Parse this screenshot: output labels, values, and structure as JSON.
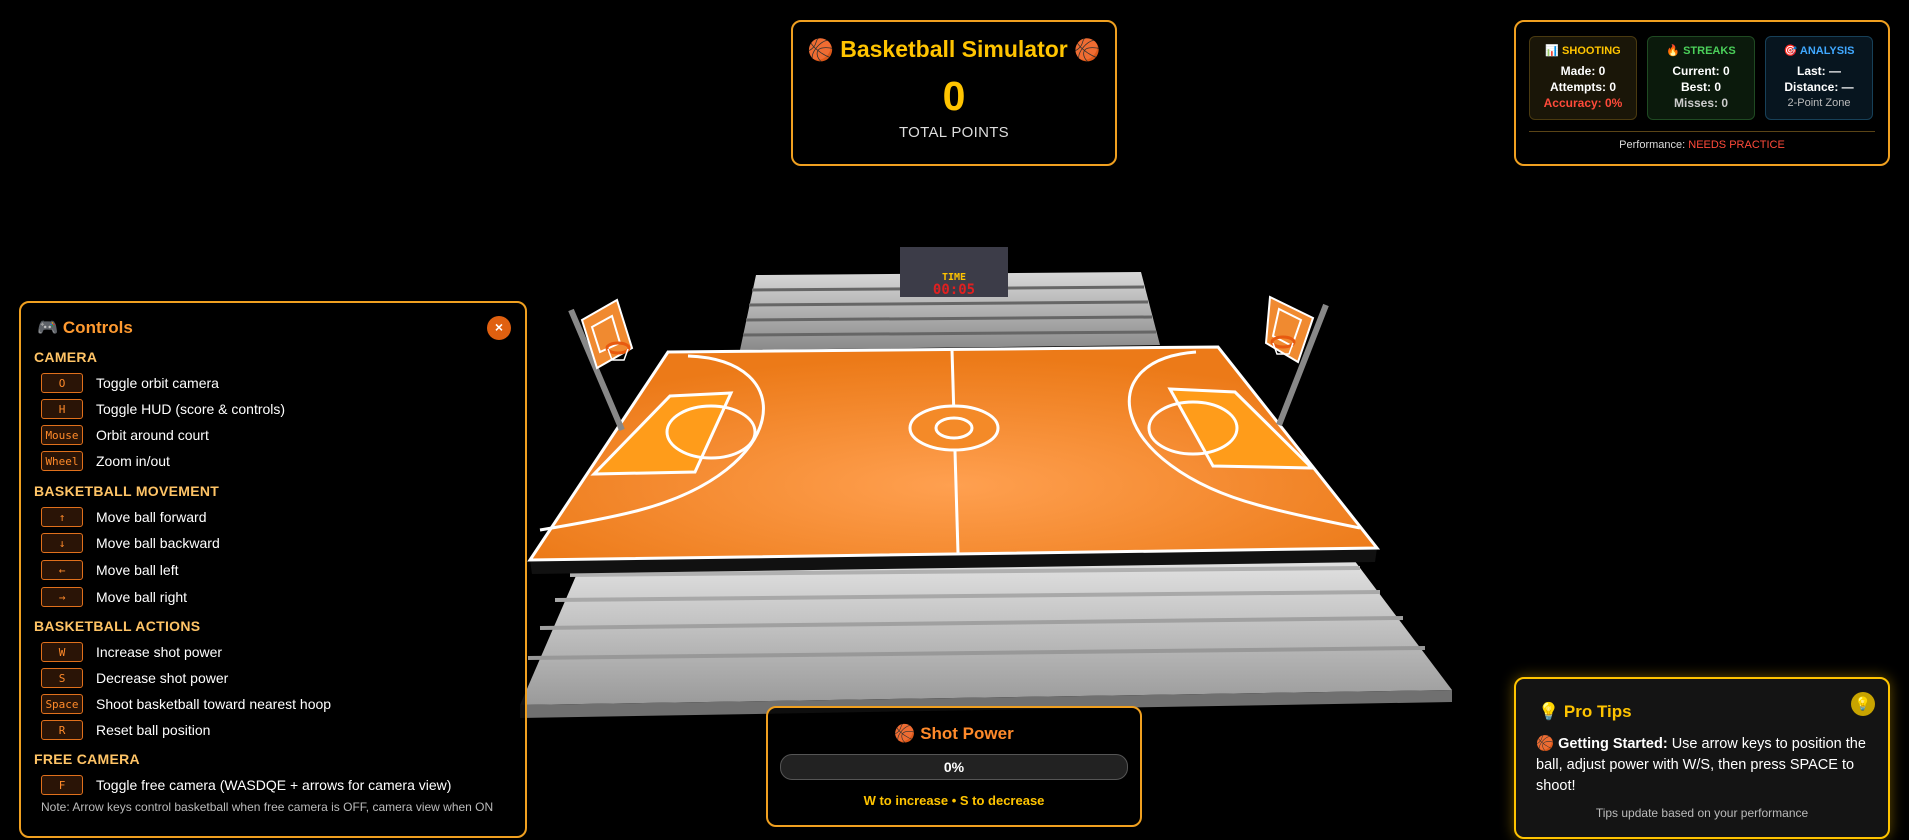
{
  "scoreboard": {
    "title": "Basketball Simulator",
    "ball_icon": "🏀",
    "points": "0",
    "points_label": "TOTAL POINTS"
  },
  "stats": {
    "shooting": {
      "icon": "📊",
      "title": "SHOOTING",
      "made": "Made: 0",
      "attempts": "Attempts: 0",
      "accuracy": "Accuracy: 0%"
    },
    "streaks": {
      "icon": "🔥",
      "title": "STREAKS",
      "current": "Current: 0",
      "best": "Best: 0",
      "misses": "Misses: 0"
    },
    "analysis": {
      "icon": "🎯",
      "title": "ANALYSIS",
      "last": "Last: —",
      "distance": "Distance: —",
      "zone": "2-Point Zone"
    },
    "performance_label": "Performance:",
    "performance_value": "NEEDS PRACTICE"
  },
  "controls": {
    "icon": "🎮",
    "title": "Controls",
    "close": "×",
    "sections": {
      "camera": "CAMERA",
      "movement": "BASKETBALL MOVEMENT",
      "actions": "BASKETBALL ACTIONS",
      "free_camera": "FREE CAMERA"
    },
    "camera": [
      {
        "key": "O",
        "desc": "Toggle orbit camera"
      },
      {
        "key": "H",
        "desc": "Toggle HUD (score & controls)"
      },
      {
        "key": "Mouse",
        "desc": "Orbit around court"
      },
      {
        "key": "Wheel",
        "desc": "Zoom in/out"
      }
    ],
    "movement": [
      {
        "key": "↑",
        "desc": "Move ball forward"
      },
      {
        "key": "↓",
        "desc": "Move ball backward"
      },
      {
        "key": "←",
        "desc": "Move ball left"
      },
      {
        "key": "→",
        "desc": "Move ball right"
      }
    ],
    "actions": [
      {
        "key": "W",
        "desc": "Increase shot power"
      },
      {
        "key": "S",
        "desc": "Decrease shot power"
      },
      {
        "key": "Space",
        "desc": "Shoot basketball toward nearest hoop"
      },
      {
        "key": "R",
        "desc": "Reset ball position"
      }
    ],
    "free_camera": [
      {
        "key": "F",
        "desc": "Toggle free camera (WASDQE + arrows for camera view)"
      }
    ],
    "note": "Note: Arrow keys control basketball when free camera is OFF, camera view when ON"
  },
  "power": {
    "icon": "🏀",
    "title": "Shot Power",
    "value": "0%",
    "fraction": 0,
    "hint": "W to increase • S to decrease"
  },
  "tips": {
    "icon": "💡",
    "title": "Pro Tips",
    "tip_icon": "🏀",
    "tip_heading": "Getting Started:",
    "tip_text": "Use arrow keys to position the ball, adjust power with W/S, then press SPACE to shoot!",
    "footer": "Tips update based on your performance"
  },
  "scene": {
    "clock_label": "TIME",
    "clock_value": "00:05",
    "court_color": "#f08020",
    "colors": {
      "accent": "#f0a020",
      "score": "#ffc400",
      "court": "#f08020"
    }
  }
}
